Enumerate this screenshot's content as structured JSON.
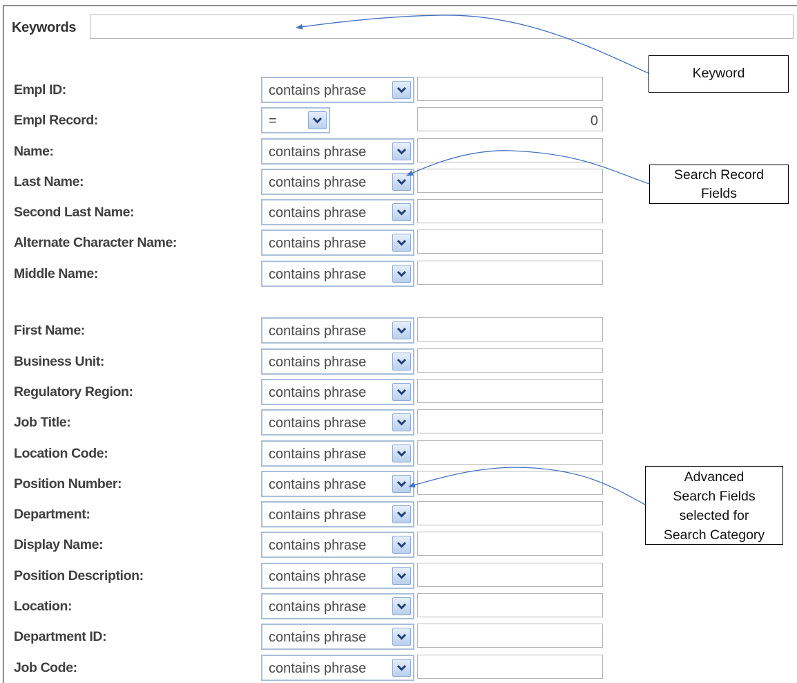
{
  "keywords": {
    "label": "Keywords",
    "value": ""
  },
  "operator_default": "contains phrase",
  "rows": [
    {
      "id": "empl-id",
      "label": "Empl ID:",
      "operator": "contains phrase",
      "value": ""
    },
    {
      "id": "empl-record",
      "label": "Empl Record:",
      "operator": "=",
      "value": "0"
    },
    {
      "id": "name",
      "label": "Name:",
      "operator": "contains phrase",
      "value": ""
    },
    {
      "id": "last-name",
      "label": "Last Name:",
      "operator": "contains phrase",
      "value": ""
    },
    {
      "id": "second-last-name",
      "label": "Second Last Name:",
      "operator": "contains phrase",
      "value": ""
    },
    {
      "id": "alternate-character-name",
      "label": "Alternate Character Name:",
      "operator": "contains phrase",
      "value": ""
    },
    {
      "id": "middle-name",
      "label": "Middle Name:",
      "operator": "contains phrase",
      "value": ""
    },
    {
      "id": "first-name",
      "label": "First Name:",
      "operator": "contains phrase",
      "value": ""
    },
    {
      "id": "business-unit",
      "label": "Business Unit:",
      "operator": "contains phrase",
      "value": ""
    },
    {
      "id": "regulatory-region",
      "label": "Regulatory Region:",
      "operator": "contains phrase",
      "value": ""
    },
    {
      "id": "job-title",
      "label": "Job Title:",
      "operator": "contains phrase",
      "value": ""
    },
    {
      "id": "location-code",
      "label": "Location Code:",
      "operator": "contains phrase",
      "value": ""
    },
    {
      "id": "position-number",
      "label": "Position Number:",
      "operator": "contains phrase",
      "value": ""
    },
    {
      "id": "department",
      "label": "Department:",
      "operator": "contains phrase",
      "value": ""
    },
    {
      "id": "display-name",
      "label": "Display Name:",
      "operator": "contains phrase",
      "value": ""
    },
    {
      "id": "position-description",
      "label": "Position Description:",
      "operator": "contains phrase",
      "value": ""
    },
    {
      "id": "location",
      "label": "Location:",
      "operator": "contains phrase",
      "value": ""
    },
    {
      "id": "department-id",
      "label": "Department ID:",
      "operator": "contains phrase",
      "value": ""
    },
    {
      "id": "job-code",
      "label": "Job Code:",
      "operator": "contains phrase",
      "value": ""
    }
  ],
  "callouts": {
    "keyword": "Keyword",
    "search_record_fields": [
      "Search Record",
      "Fields"
    ],
    "advanced_search_fields": [
      "Advanced",
      "Search Fields",
      "selected for",
      "Search Category"
    ]
  },
  "colors": {
    "arrow": "#4472c4",
    "select_border": "#a9bed9",
    "input_border": "#b5b5b5"
  }
}
